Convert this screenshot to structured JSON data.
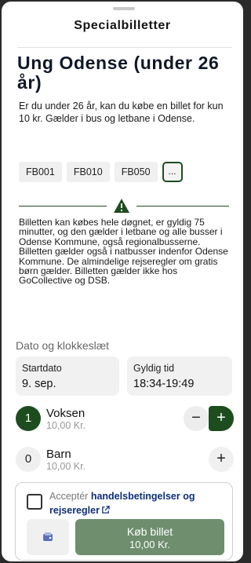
{
  "sheet": {
    "title": "Specialbilletter"
  },
  "ticket": {
    "title": "Ung Odense (under 26 år)",
    "description": "Er du under 26 år, kan du købe en billet for kun 10 kr. Gælder i bus og letbane i Odense.",
    "codes": [
      "FB001",
      "FB010",
      "FB050"
    ],
    "more_label": "...",
    "warning_icon": "warning-triangle-icon",
    "notice": "Billetten kan købes hele døgnet, er gyldig 75 minutter, og den gælder i letbane og alle busser i Odense Kommune, også regionalbusserne. Billetten gælder også i natbusser indenfor Odense Kommune. De almindelige rejseregler om gratis børn gælder. Billetten gælder ikke hos GoCollective og DSB."
  },
  "datetime": {
    "section_label": "Dato og klokkeslæt",
    "start_label": "Startdato",
    "start_value": "9. sep.",
    "valid_label": "Gyldig tid",
    "valid_value": "18:34-19:49"
  },
  "passengers": [
    {
      "count": "1",
      "name": "Voksen",
      "price": "10,00 Kr."
    },
    {
      "count": "0",
      "name": "Barn",
      "price": "10,00 Kr."
    }
  ],
  "stepper": {
    "minus": "−",
    "plus": "+"
  },
  "footer": {
    "accept_prefix": "Acceptér",
    "terms_link": "handelsbetingelser og",
    "rules_link": "rejseregler",
    "buy_label": "Køb billet",
    "buy_price": "10,00 Kr."
  },
  "colors": {
    "accent": "#1d4d1f",
    "buy_button": "#6e8e6e",
    "link": "#0f2f7a"
  }
}
